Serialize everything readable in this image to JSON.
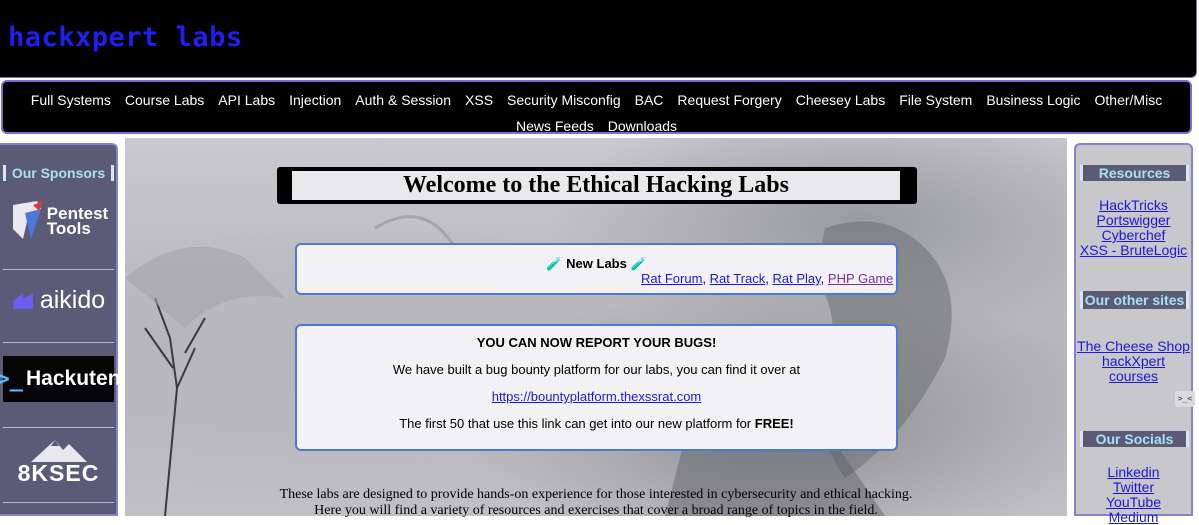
{
  "header": {
    "title": "hackxpert labs"
  },
  "nav": {
    "items": [
      "Full Systems",
      "Course Labs",
      "API Labs",
      "Injection",
      "Auth & Session",
      "XSS",
      "Security Misconfig",
      "BAC",
      "Request Forgery",
      "Cheesey Labs",
      "File System",
      "Business Logic",
      "Other/Misc"
    ],
    "items_row2": [
      "News Feeds",
      "Downloads"
    ]
  },
  "sidebar_left": {
    "title": "Our Sponsors",
    "sponsors": [
      {
        "name": "Pentest Tools",
        "line1": "Pentest",
        "line2": "Tools",
        "icon": "pentest-tools-shield-icon"
      },
      {
        "name": "aikido",
        "icon": "aikido-logo-icon"
      },
      {
        "name": "Hackuten",
        "prompt": ">_",
        "icon": "hackuten-logo-icon"
      },
      {
        "name": "8KSEC",
        "icon": "8ksec-mountain-icon"
      }
    ]
  },
  "main": {
    "welcome": "Welcome to the Ethical Hacking Labs",
    "new_labs": {
      "title": "New Labs",
      "emoji": "🧪",
      "links": [
        "Rat Forum",
        "Rat Track",
        "Rat Play",
        "PHP Game"
      ],
      "separator": ", "
    },
    "bug_bounty": {
      "heading": "YOU CAN NOW REPORT YOUR BUGS!",
      "line1": "We have built a bug bounty platform for our labs, you can find it over at",
      "link": "https://bountyplatform.thexssrat.com",
      "line3_prefix": "The first 50 that use this link can get into our new platform for ",
      "line3_bold": "FREE!"
    },
    "intro_line1": "These labs are designed to provide hands-on experience for those interested in cybersecurity and ethical hacking.",
    "intro_line2": "Here you will find a variety of resources and exercises that cover a broad range of topics in the field."
  },
  "sidebar_right": {
    "resources_title": "Resources",
    "resources": [
      "HackTricks",
      "Portswigger",
      "Cyberchef",
      "XSS - BruteLogic"
    ],
    "other_title": "Our other sites",
    "other_sites": [
      "The Cheese Shop",
      "hackXpert courses"
    ],
    "socials_title": "Our Socials",
    "socials": [
      "Linkedin",
      "Twitter",
      "YouTube",
      "Medium"
    ]
  },
  "widget": {
    "label": ">_<"
  },
  "colors": {
    "link": "#1a1ad6",
    "accent_border": "#7a6fd1",
    "box_border": "#4a79d8",
    "logo": "#1f1ff0"
  }
}
